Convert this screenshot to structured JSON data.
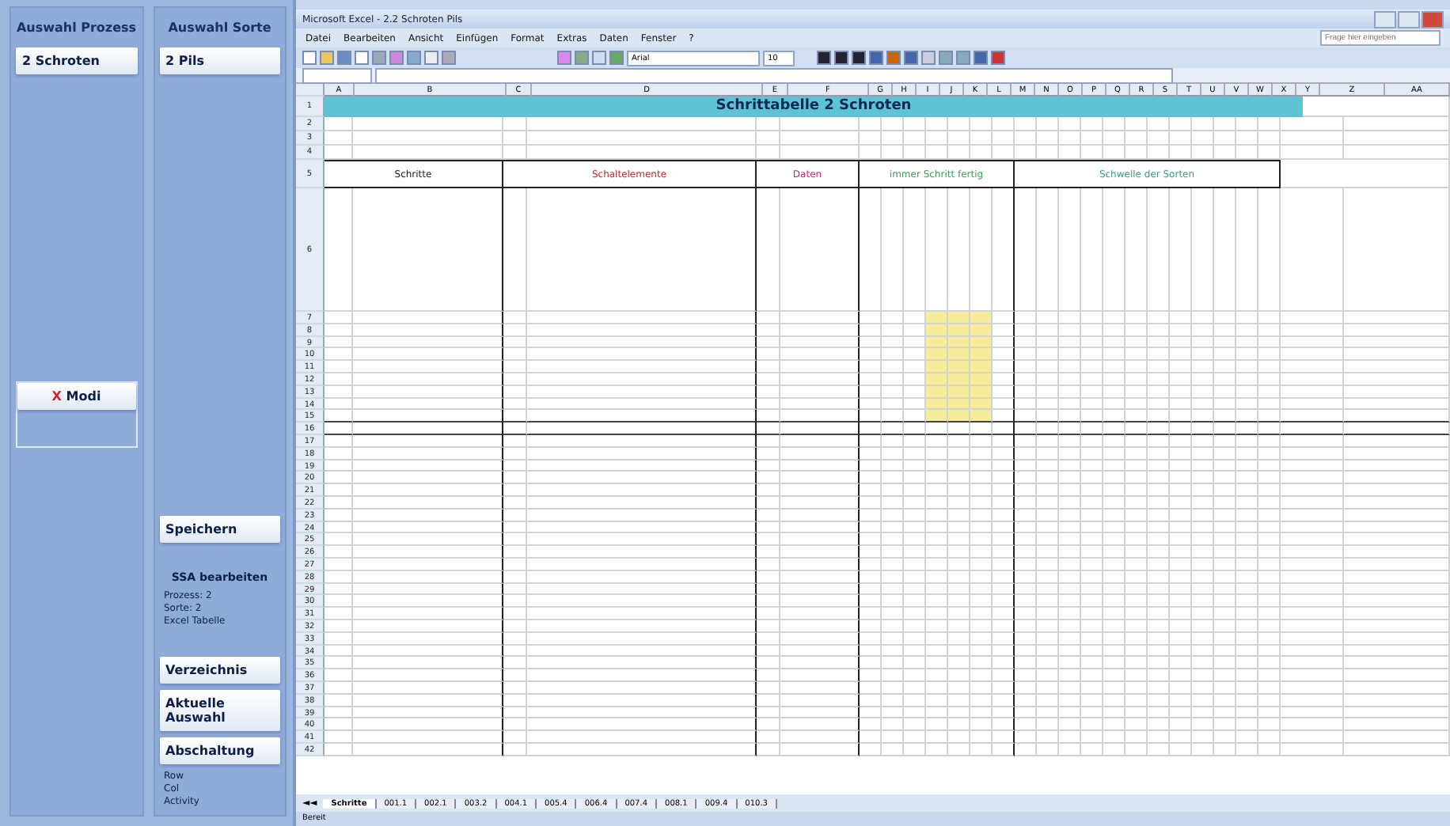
{
  "left_panel": {
    "process": {
      "heading": "Auswahl Prozess",
      "value": "2 Schroten"
    },
    "sort": {
      "heading": "Auswahl Sorte",
      "value": "2 Pils"
    },
    "modi_button": {
      "mark": "X",
      "label": "Modi"
    },
    "save_button": "Speichern",
    "info": {
      "title": "SSA bearbeiten",
      "lines": [
        "Prozess: 2",
        "Sorte: 2",
        "Excel Tabelle"
      ]
    },
    "buttons": [
      "Verzeichnis",
      "Aktuelle Auswahl",
      "Abschaltung"
    ],
    "status_lines": [
      "Row",
      "Col",
      "Activity"
    ]
  },
  "excel": {
    "title": "Microsoft Excel - 2.2 Schroten Pils",
    "menu": [
      "Datei",
      "Bearbeiten",
      "Ansicht",
      "Einfügen",
      "Format",
      "Extras",
      "Daten",
      "Fenster",
      "?"
    ],
    "help_placeholder": "Frage hier eingeben",
    "font": "Arial",
    "size": "10",
    "columns": [
      "A",
      "B",
      "C",
      "D",
      "E",
      "F",
      "G",
      "H",
      "I",
      "J",
      "K",
      "L",
      "M",
      "N",
      "O",
      "P",
      "Q",
      "R",
      "S",
      "T",
      "U",
      "V",
      "W",
      "X",
      "Y",
      "Z",
      "AA"
    ],
    "top_row_numbers": [
      "1",
      "2",
      "3",
      "4",
      "5",
      "6"
    ],
    "sheet_title": "Schrittabelle 2 Schroten",
    "groups": [
      {
        "label": "Schritte",
        "color": "#1a1a1a"
      },
      {
        "label": "Schaltelemente",
        "color": "#c0282c"
      },
      {
        "label": "Daten",
        "color": "#c0287a"
      },
      {
        "label": "immer Schritt fertig",
        "color": "#3a9a5a"
      },
      {
        "label": "Schwelle der Sorten",
        "color": "#3a9a8a"
      }
    ],
    "rows": [
      {
        "number": "7",
        "highlight": true
      },
      {
        "number": "8",
        "highlight": true
      },
      {
        "number": "9",
        "highlight": true
      },
      {
        "number": "10",
        "highlight": true
      },
      {
        "number": "11",
        "highlight": true
      },
      {
        "number": "12",
        "highlight": true
      },
      {
        "number": "13",
        "highlight": true
      },
      {
        "number": "14",
        "highlight": true
      },
      {
        "number": "15",
        "highlight": true
      },
      {
        "number": "16",
        "highlight": false
      },
      {
        "number": "17",
        "highlight": false
      },
      {
        "number": "18",
        "highlight": false
      },
      {
        "number": "19",
        "highlight": false
      },
      {
        "number": "20",
        "highlight": false
      },
      {
        "number": "21",
        "highlight": false
      },
      {
        "number": "22",
        "highlight": false
      },
      {
        "number": "23",
        "highlight": false
      },
      {
        "number": "24",
        "highlight": false
      },
      {
        "number": "25",
        "highlight": false
      },
      {
        "number": "26",
        "highlight": false
      },
      {
        "number": "27",
        "highlight": false
      },
      {
        "number": "28",
        "highlight": false
      },
      {
        "number": "29",
        "highlight": false
      },
      {
        "number": "30",
        "highlight": false
      },
      {
        "number": "31",
        "highlight": false
      },
      {
        "number": "32",
        "highlight": false
      },
      {
        "number": "33",
        "highlight": false
      },
      {
        "number": "34",
        "highlight": false
      },
      {
        "number": "35",
        "highlight": false
      },
      {
        "number": "36",
        "highlight": false
      },
      {
        "number": "37",
        "highlight": false
      },
      {
        "number": "38",
        "highlight": false
      },
      {
        "number": "39",
        "highlight": false
      },
      {
        "number": "40",
        "highlight": false
      },
      {
        "number": "41",
        "highlight": false
      },
      {
        "number": "42",
        "highlight": false
      }
    ],
    "tab_nav": "◄◄",
    "sheet_tabs": [
      {
        "label": "Schritte",
        "selected": true
      },
      {
        "label": "001.1",
        "selected": false
      },
      {
        "label": "002.1",
        "selected": false
      },
      {
        "label": "003.2",
        "selected": false
      },
      {
        "label": "004.1",
        "selected": false
      },
      {
        "label": "005.4",
        "selected": false
      },
      {
        "label": "006.4",
        "selected": false
      },
      {
        "label": "007.4",
        "selected": false
      },
      {
        "label": "008.1",
        "selected": false
      },
      {
        "label": "009.4",
        "selected": false
      },
      {
        "label": "010.3",
        "selected": false
      }
    ],
    "status": "Bereit"
  }
}
